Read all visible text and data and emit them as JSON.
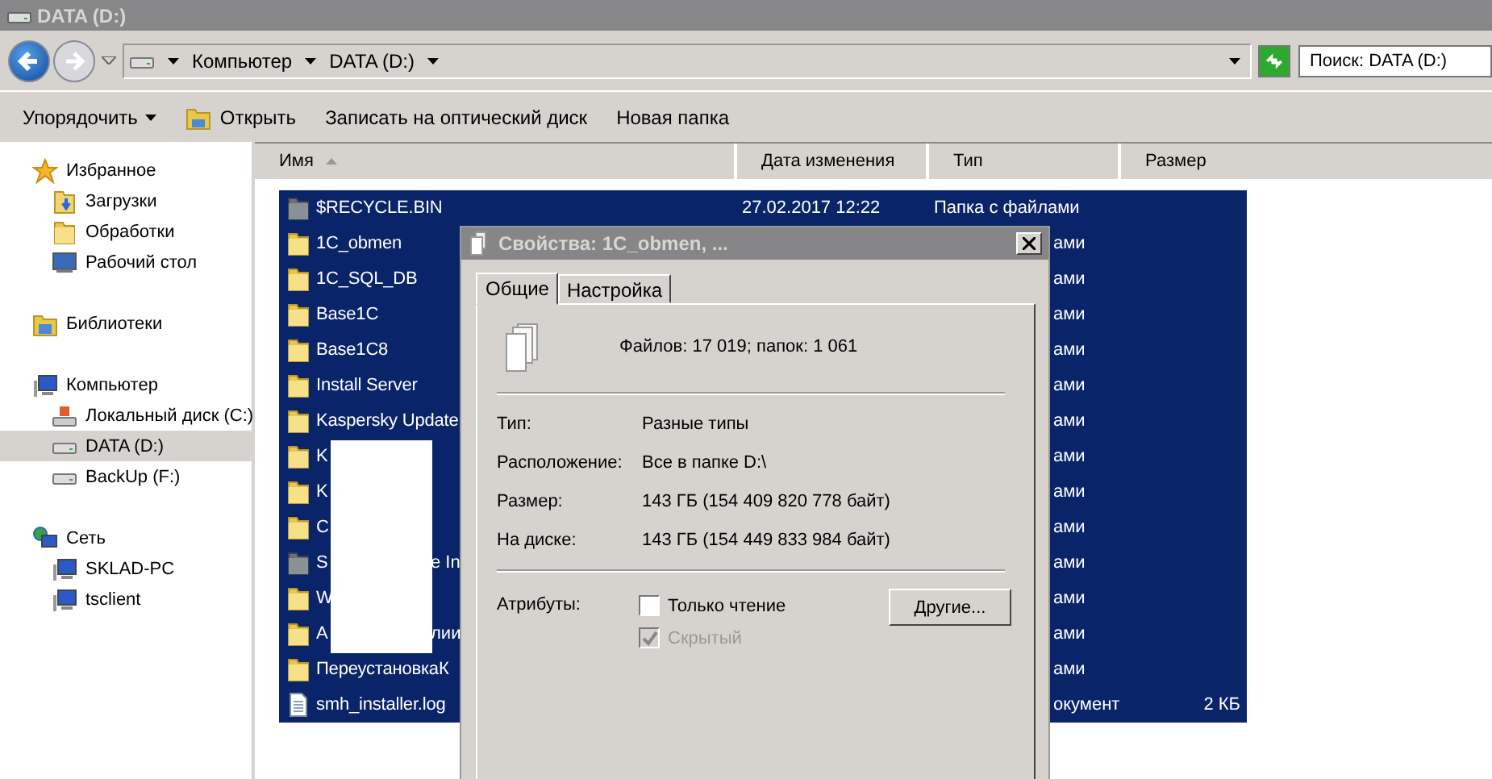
{
  "window": {
    "title": "DATA (D:)"
  },
  "breadcrumb": [
    "Компьютер",
    "DATA (D:)"
  ],
  "search": {
    "placeholder": "Поиск: DATA (D:)"
  },
  "toolbar": [
    {
      "label": "Упорядочить",
      "kind": "menu"
    },
    {
      "label": "Открыть",
      "kind": "open"
    },
    {
      "label": "Записать на оптический диск",
      "kind": "plain"
    },
    {
      "label": "Новая папка",
      "kind": "plain"
    }
  ],
  "sidebar": [
    {
      "label": "Избранное",
      "kind": "star",
      "selected": false,
      "children": [
        {
          "label": "Загрузки",
          "kind": "downloads",
          "selected": false
        },
        {
          "label": "Обработки",
          "kind": "folder",
          "selected": false
        },
        {
          "label": "Рабочий стол",
          "kind": "desktop",
          "selected": false
        }
      ]
    },
    {
      "label": "Библиотеки",
      "kind": "library",
      "selected": false
    },
    {
      "label": "Компьютер",
      "kind": "computer",
      "selected": false,
      "children": [
        {
          "label": "Локальный диск (C:)",
          "kind": "system-drive",
          "selected": false
        },
        {
          "label": "DATA (D:)",
          "kind": "drive",
          "selected": true
        },
        {
          "label": "BackUp (F:)",
          "kind": "drive",
          "selected": false
        }
      ]
    },
    {
      "label": "Сеть",
      "kind": "network",
      "selected": false,
      "children": [
        {
          "label": "SKLAD-PC",
          "kind": "computer",
          "selected": false
        },
        {
          "label": "tsclient",
          "kind": "computer",
          "selected": false
        }
      ]
    }
  ],
  "table": {
    "columns": [
      {
        "label": "Имя",
        "sorted": true
      },
      {
        "label": "Дата изменения",
        "sorted": false
      },
      {
        "label": "Тип",
        "sorted": false
      },
      {
        "label": "Размер",
        "sorted": false
      }
    ],
    "rows": [
      {
        "kind": "system-folder",
        "name": "$RECYCLE.BIN",
        "date": "27.02.2017 12:22",
        "type": "Папка с файлами",
        "covered": false,
        "selected": true
      },
      {
        "kind": "folder",
        "name": "1C_obmen",
        "type": "ами",
        "covered": true,
        "selected": true
      },
      {
        "kind": "folder",
        "name": "1C_SQL_DB",
        "type": "ами",
        "covered": true,
        "selected": true
      },
      {
        "kind": "folder",
        "name": "Base1C",
        "type": "ами",
        "covered": true,
        "selected": true
      },
      {
        "kind": "folder",
        "name": "Base1C8",
        "type": "ами",
        "covered": true,
        "selected": true
      },
      {
        "kind": "folder",
        "name": "Install Server",
        "type": "ами",
        "covered": true,
        "selected": true
      },
      {
        "kind": "folder",
        "name": "Kaspersky Update",
        "type": "ами",
        "covered": true,
        "selected": true
      },
      {
        "kind": "folder",
        "name": "K",
        "type": "ами",
        "covered": true,
        "selected": true
      },
      {
        "kind": "folder",
        "name": "K",
        "type": "ами",
        "covered": true,
        "selected": true
      },
      {
        "kind": "folder",
        "name": "C",
        "type": "ами",
        "covered": true,
        "selected": true
      },
      {
        "kind": "system-folder",
        "name": "S",
        "name_tail": "e In",
        "type": "ами",
        "covered": true,
        "selected": true
      },
      {
        "kind": "folder",
        "name": "W",
        "type": "ами",
        "covered": true,
        "selected": true
      },
      {
        "kind": "folder",
        "name": "А",
        "name_tail": "лии",
        "type": "ами",
        "covered": true,
        "selected": true
      },
      {
        "kind": "folder",
        "name": "ПереустановкаК",
        "type": "ами",
        "covered": true,
        "selected": true
      },
      {
        "kind": "file",
        "name": "smh_installer.log",
        "type": "окумент",
        "size": "2 КБ",
        "covered": true,
        "selected": true
      }
    ]
  },
  "dialog": {
    "title": "Свойства: 1C_obmen, ...",
    "tabs": [
      {
        "label": "Общие",
        "selected": true
      },
      {
        "label": "Настройка",
        "selected": false
      }
    ],
    "summary": "Файлов: 17 019; папок: 1 061",
    "properties": [
      {
        "label": "Тип:",
        "value": "Разные типы"
      },
      {
        "label": "Расположение:",
        "value": "Все в папке D:\\"
      },
      {
        "label": "Размер:",
        "value": "143 ГБ (154 409 820 778 байт)"
      },
      {
        "label": "На диске:",
        "value": "143 ГБ (154 449 833 984 байт)"
      }
    ],
    "attributes_label": "Атрибуты:",
    "attributes": [
      {
        "label": "Только чтение",
        "checked": false,
        "disabled": false
      },
      {
        "label": "Скрытый",
        "checked": true,
        "disabled": true
      }
    ],
    "more_button": "Другие..."
  }
}
